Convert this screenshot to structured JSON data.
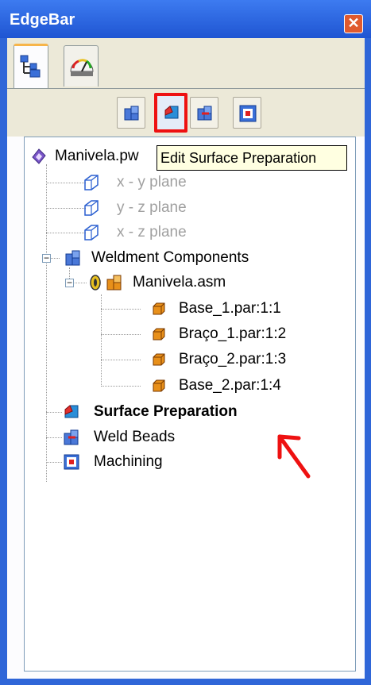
{
  "window": {
    "title": "EdgeBar",
    "close_glyph": "✕"
  },
  "tabs": [
    {
      "name": "feature-pathfinder-tab",
      "icon": "tree-icon"
    },
    {
      "name": "gauge-tab",
      "icon": "gauge-icon"
    }
  ],
  "toolbar": {
    "buttons": [
      {
        "icon": "weldment-components-icon"
      },
      {
        "icon": "surface-preparation-icon",
        "active": true
      },
      {
        "icon": "weld-beads-icon"
      },
      {
        "icon": "machining-icon"
      }
    ]
  },
  "tooltip": {
    "text": "Edit Surface Preparation"
  },
  "tree": {
    "root": "Manivela.pw",
    "planes": [
      "x - y plane",
      "y - z plane",
      "x - z plane"
    ],
    "weldment": "Weldment Components",
    "assembly": "Manivela.asm",
    "parts": [
      "Base_1.par:1:1",
      "Braço_1.par:1:2",
      "Braço_2.par:1:3",
      "Base_2.par:1:4"
    ],
    "surface_prep": "Surface Preparation",
    "weld_beads": "Weld Beads",
    "machining": "Machining"
  },
  "colors": {
    "title_bar": "#2f66d8",
    "highlight_box": "#ee1111",
    "arrow": "#ee1111"
  }
}
